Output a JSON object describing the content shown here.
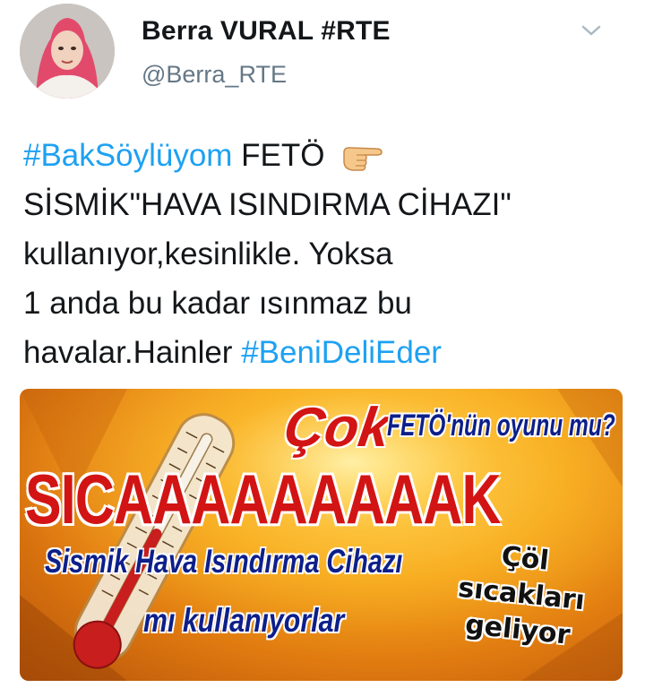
{
  "tweet": {
    "author_name": "Berra VURAL #RTE",
    "handle": "@Berra_RTE",
    "avatar_icon": "user-avatar-photo",
    "menu_icon": "chevron-down-icon",
    "text": {
      "hashtag1": "#BakSöylüyom",
      "line1_rest": " FETÖ",
      "line2": "SİSMİK\"HAVA ISINDIRMA CİHAZI\"",
      "line3": "kullanıyor,kesinlikle. Yoksa",
      "line4": "1 anda bu kadar ısınmaz bu",
      "line5_start": "havalar.Hainler ",
      "hashtag2": "#BeniDeliEder"
    },
    "hashtag_color": "#1da1f2"
  },
  "media": {
    "headline_cok": "Çok",
    "headline_feto": "FETÖ'nün oyunu mu?",
    "headline_sicak": "SICAAAAAAAAAK",
    "subline1": "Sismik Hava Isındırma Cihazı",
    "subline2": "mı kullanıyorlar",
    "badge_line1": "Çöl",
    "badge_line2": "sıcakları",
    "badge_line3": "geliyor"
  }
}
